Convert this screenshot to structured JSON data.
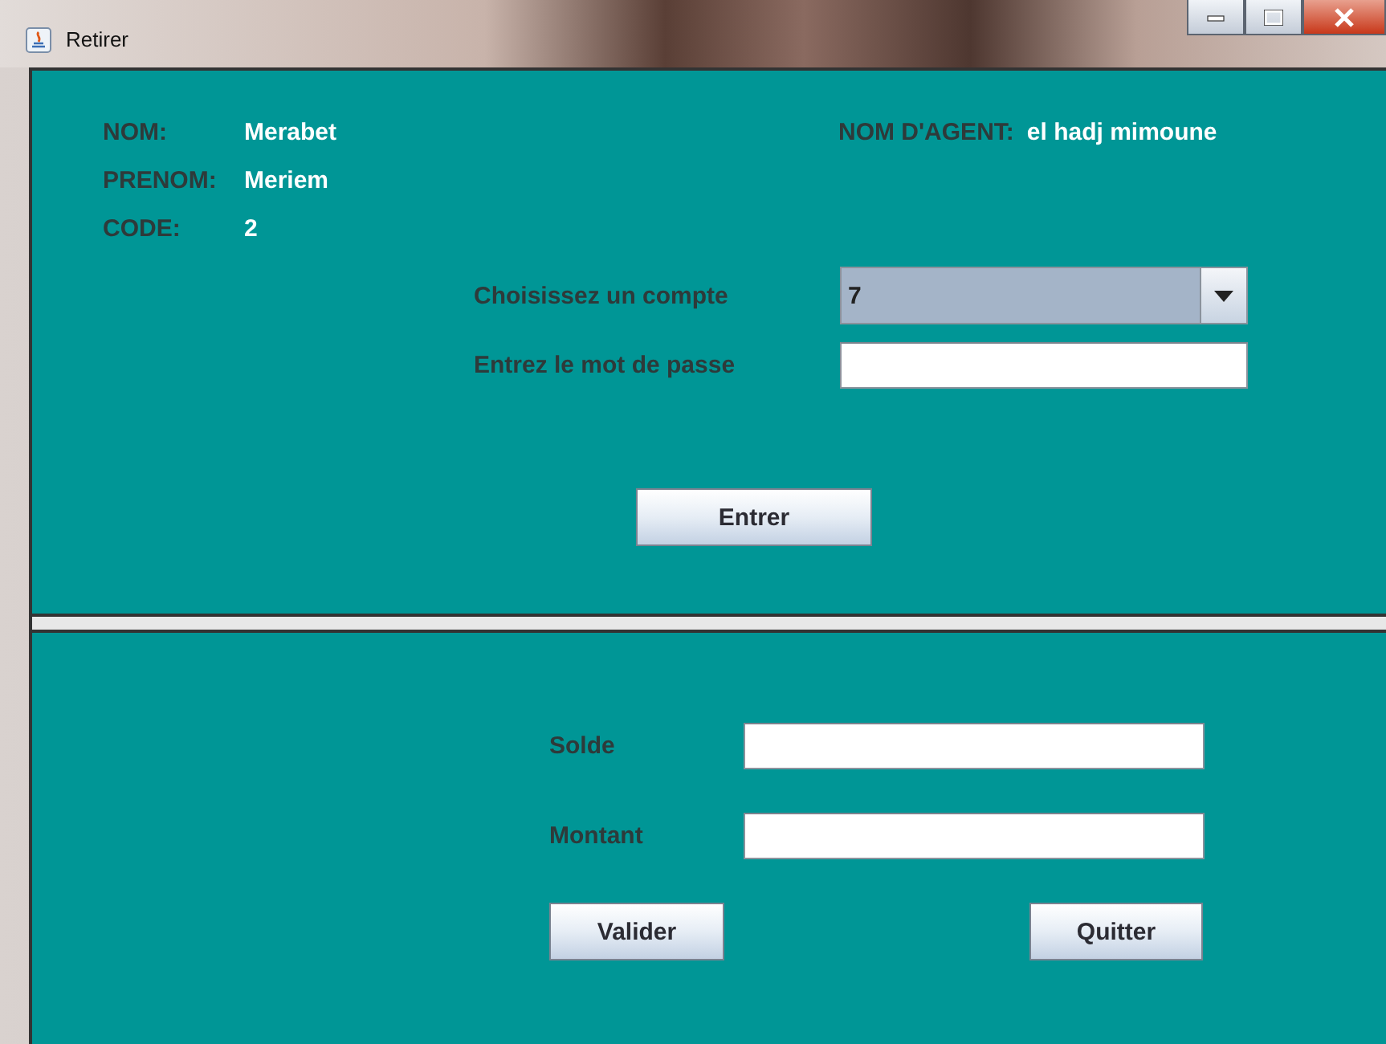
{
  "window": {
    "title": "Retirer"
  },
  "client": {
    "fields": [
      {
        "label": "NOM:",
        "value": "Merabet"
      },
      {
        "label": "PRENOM:",
        "value": "Meriem"
      },
      {
        "label": "CODE:",
        "value": "2"
      }
    ],
    "agent": {
      "label": "NOM D'AGENT:",
      "value": "el hadj mimoune"
    }
  },
  "account_form": {
    "account_label": "Choisissez un compte",
    "account_value": "7",
    "password_label": "Entrez le mot de passe",
    "submit": "Entrer"
  },
  "withdraw_form": {
    "balance_label": "Solde",
    "amount_label": "Montant",
    "buttons": [
      "Valider",
      "Quitter"
    ]
  }
}
